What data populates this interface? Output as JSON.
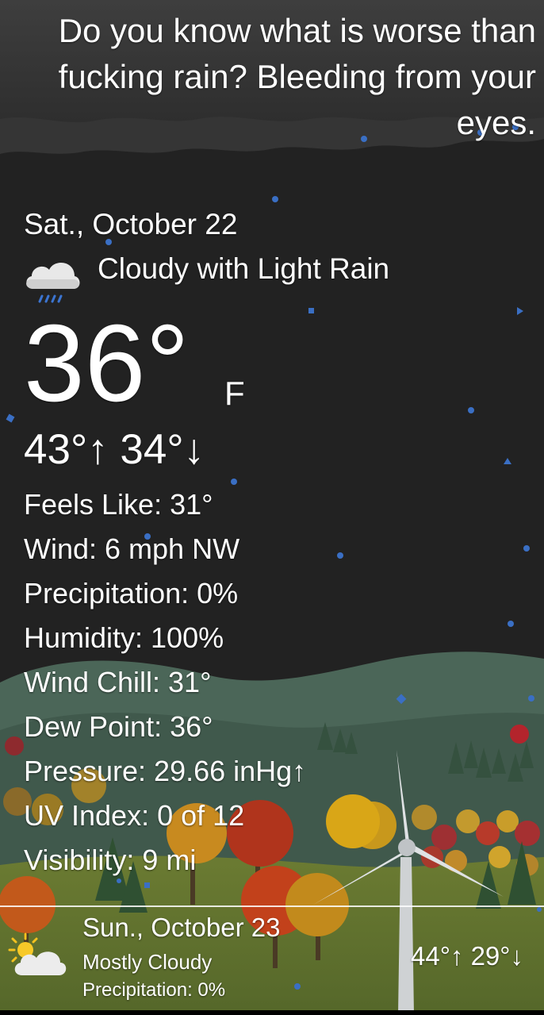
{
  "quote": "Do you know what is worse than fucking rain? Bleeding from your eyes.",
  "current": {
    "date": "Sat., October 22",
    "condition": "Cloudy with Light Rain",
    "condition_icon": "cloud-rain-icon",
    "temperature": "36°",
    "unit": "F",
    "hi_lo": "43°↑ 34°↓"
  },
  "details": [
    "Feels Like: 31°",
    "Wind: 6 mph NW",
    "Precipitation: 0%",
    "Humidity: 100%",
    "Wind Chill: 31°",
    "Dew Point: 36°",
    "Pressure: 29.66 inHg↑",
    "UV Index: 0 of 12",
    "Visibility: 9 mi"
  ],
  "forecast": {
    "date": "Sun., October 23",
    "condition": "Mostly Cloudy",
    "condition_icon": "sun-cloud-icon",
    "precipitation": "Precipitation: 0%",
    "hi_lo": "44°↑ 29°↓"
  },
  "colors": {
    "background": "#232323",
    "rain_particles": "#3a6fc4",
    "hills": "#4a6a55",
    "grass": "#6f7d2e",
    "accent_text": "#ffffff"
  }
}
